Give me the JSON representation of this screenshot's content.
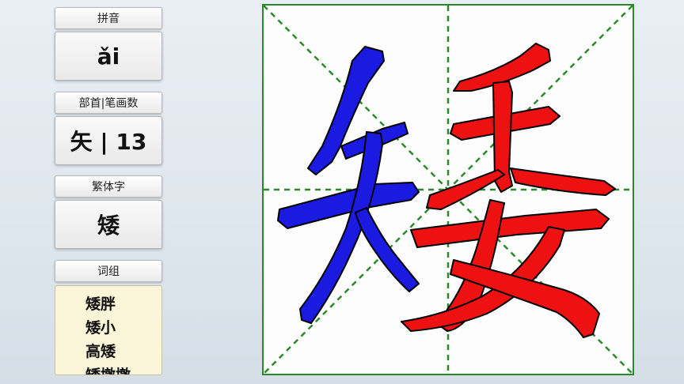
{
  "sidebar": {
    "pinyin_label": "拼音",
    "pinyin_value": "ǎi",
    "radical_label": "部首|笔画数",
    "radical_value": "矢 | 13",
    "traditional_label": "繁体字",
    "traditional_value": "矮",
    "words_label": "词组",
    "words": [
      "矮胖",
      "矮小",
      "高矮",
      "矮墩墩"
    ]
  },
  "character": {
    "glyph": "矮",
    "left_component_color": "#1a1ae0",
    "right_component_color": "#ee1111",
    "grid_color": "#2a8a2a"
  }
}
